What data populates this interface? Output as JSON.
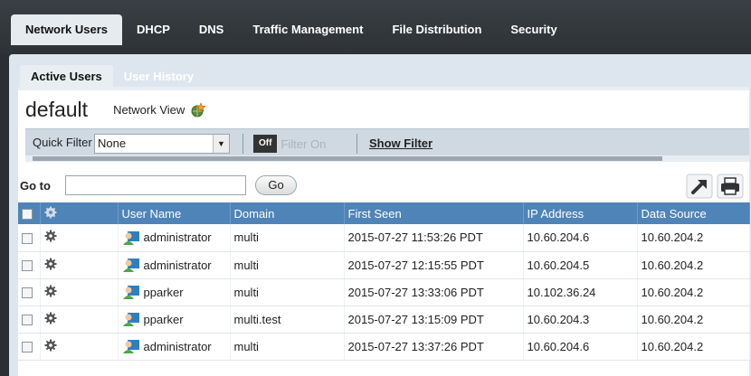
{
  "nav": {
    "tabs": [
      "Network Users",
      "DHCP",
      "DNS",
      "Traffic Management",
      "File Distribution",
      "Security"
    ]
  },
  "subtabs": [
    "Active Users",
    "User History"
  ],
  "header": {
    "title": "default",
    "network_view_label": "Network View"
  },
  "filter": {
    "quick_filter_label": "Quick Filter",
    "quick_filter_value": "None",
    "toggle_off": "Off",
    "toggle_on": "Filter On",
    "show_filter": "Show Filter"
  },
  "goto": {
    "label": "Go to",
    "value": "",
    "button": "Go"
  },
  "table": {
    "columns": [
      "User Name",
      "Domain",
      "First Seen",
      "IP Address",
      "Data Source"
    ],
    "rows": [
      {
        "user": "administrator",
        "domain": "multi",
        "first_seen": "2015-07-27 11:53:26 PDT",
        "ip": "10.60.204.6",
        "source": "10.60.204.2"
      },
      {
        "user": "administrator",
        "domain": "multi",
        "first_seen": "2015-07-27 12:15:55 PDT",
        "ip": "10.60.204.5",
        "source": "10.60.204.2"
      },
      {
        "user": "pparker",
        "domain": "multi",
        "first_seen": "2015-07-27 13:33:06 PDT",
        "ip": "10.102.36.24",
        "source": "10.60.204.2"
      },
      {
        "user": "pparker",
        "domain": "multi.test",
        "first_seen": "2015-07-27 13:15:09 PDT",
        "ip": "10.60.204.3",
        "source": "10.60.204.2"
      },
      {
        "user": "administrator",
        "domain": "multi",
        "first_seen": "2015-07-27 13:37:26 PDT",
        "ip": "10.60.204.6",
        "source": "10.60.204.2"
      }
    ]
  },
  "icons": {
    "network_view": "globe-star-icon",
    "gear": "gear-icon",
    "user": "user-icon",
    "export": "export-arrow-icon",
    "print": "print-icon"
  },
  "colors": {
    "header_blue": "#4f84b8",
    "nav_dark": "#2e3236",
    "panel": "#dde6ee"
  }
}
